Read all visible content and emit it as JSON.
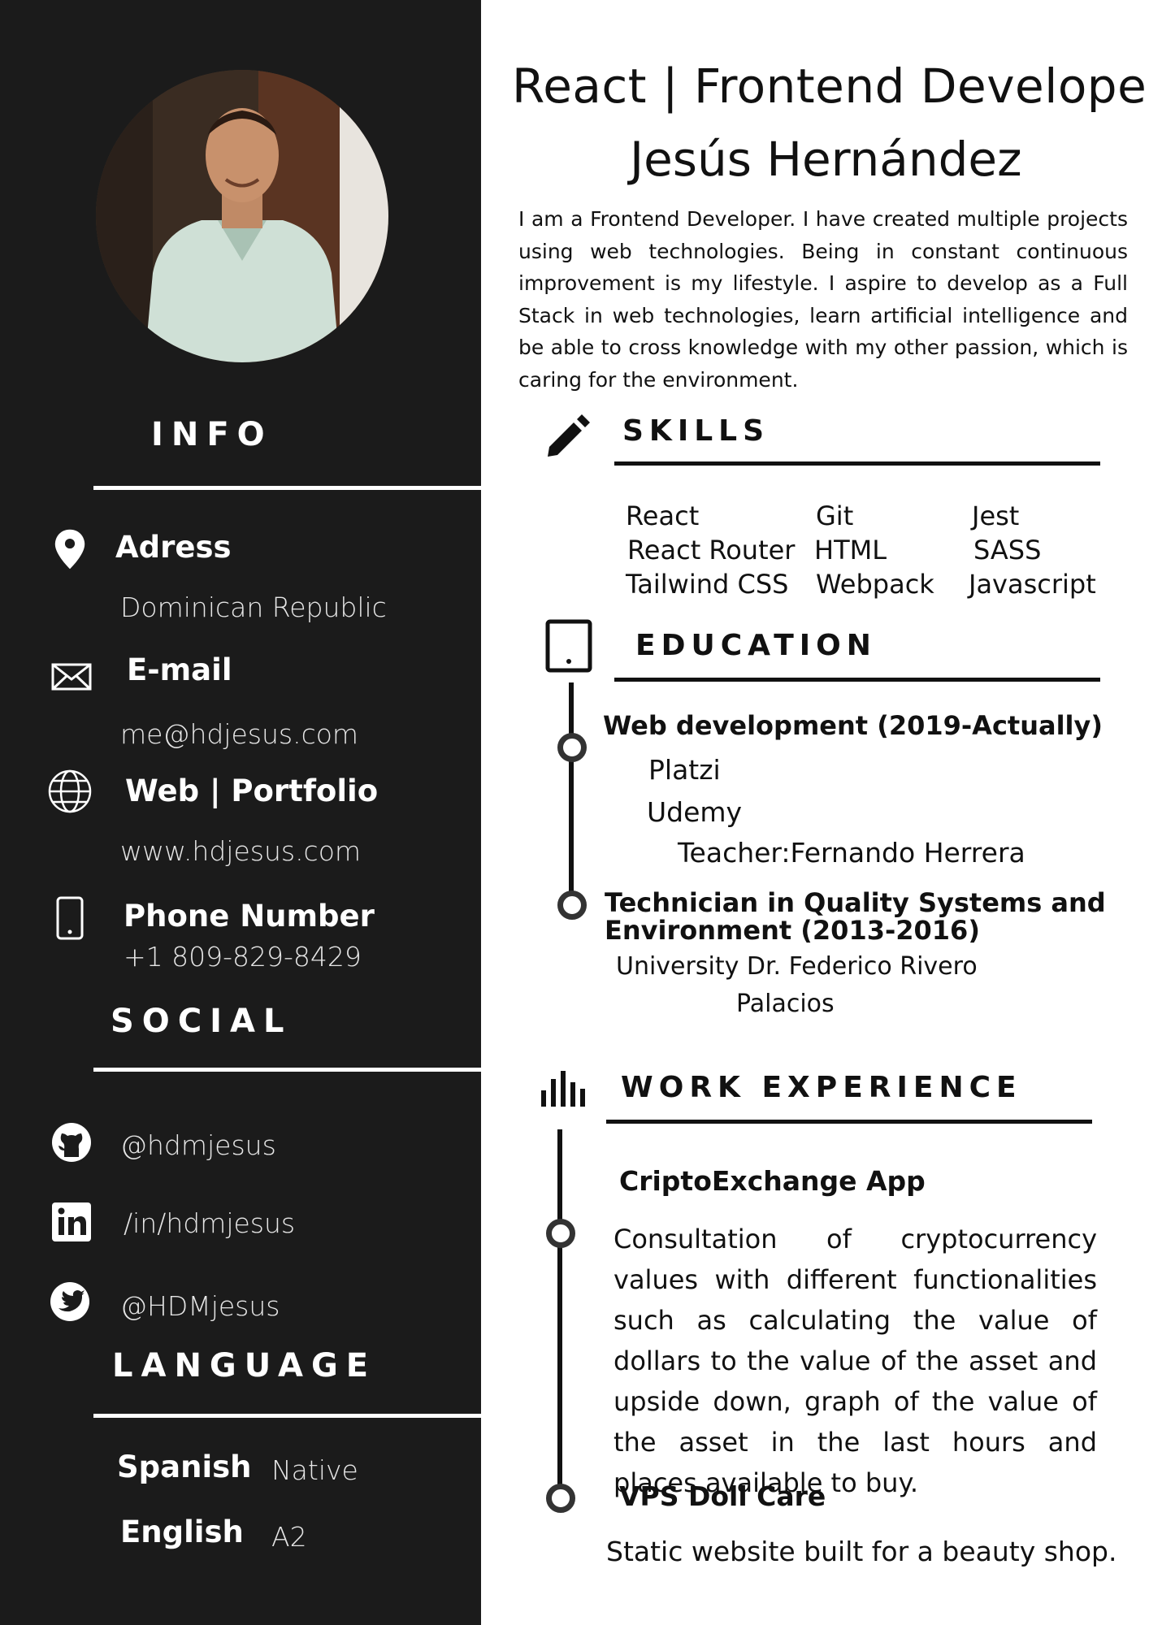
{
  "header": {
    "title": "React | Frontend Developer",
    "name": "Jesús Hernández",
    "about": "I am a Frontend Developer. I have created multiple projects using web technologies. Being in constant continuous improvement is my lifestyle. I aspire to develop as a Full Stack in web technologies, learn artificial intelligence and be able to cross knowledge with my other passion, which is caring for the environment."
  },
  "sidebar": {
    "info_heading": "INFO",
    "address_label": "Adress",
    "address_value": "Dominican Republic",
    "email_label": "E-mail",
    "email_value": "me@hdjesus.com",
    "web_label": "Web | Portfolio",
    "web_value": "www.hdjesus.com",
    "phone_label": "Phone Number",
    "phone_value": "+1 809-829-8429",
    "social_heading": "SOCIAL",
    "github": "@hdmjesus",
    "linkedin": "/in/hdmjesus",
    "twitter": "@HDMjesus",
    "language_heading": "LANGUAGE",
    "languages": [
      {
        "name": "Spanish",
        "level": "Native"
      },
      {
        "name": "English",
        "level": "A2"
      }
    ]
  },
  "skills": {
    "heading": "SKILLS",
    "col1": [
      "React",
      "React Router",
      "Tailwind CSS"
    ],
    "col2": [
      "Git",
      "HTML",
      "Webpack"
    ],
    "col3": [
      "Jest",
      "SASS",
      "Javascript"
    ]
  },
  "education": {
    "heading": "EDUCATION",
    "item1_title": "Web development  (2019-Actually)",
    "item1_lines": [
      "Platzi",
      "Udemy",
      "Teacher:Fernando Herrera"
    ],
    "item2_title_line1": "Technician in Quality Systems and",
    "item2_title_line2": "Environment (2013-2016)",
    "item2_lines": [
      "University Dr. Federico Rivero",
      "Palacios"
    ]
  },
  "work": {
    "heading": "WORK EXPERIENCE",
    "job1_title": "CriptoExchange App",
    "job1_desc": "Consultation of cryptocurrency values with different functionalities such as calculating the value of dollars to the value of the asset and upside down, graph of the value of the asset in the last hours and places available to buy.",
    "job2_title": "VPS Doll Care",
    "job2_desc": "Static website built for a beauty shop."
  },
  "colors": {
    "sidebar_bg": "#1b1b1b",
    "text": "#111111",
    "accent": "#ffffff"
  }
}
